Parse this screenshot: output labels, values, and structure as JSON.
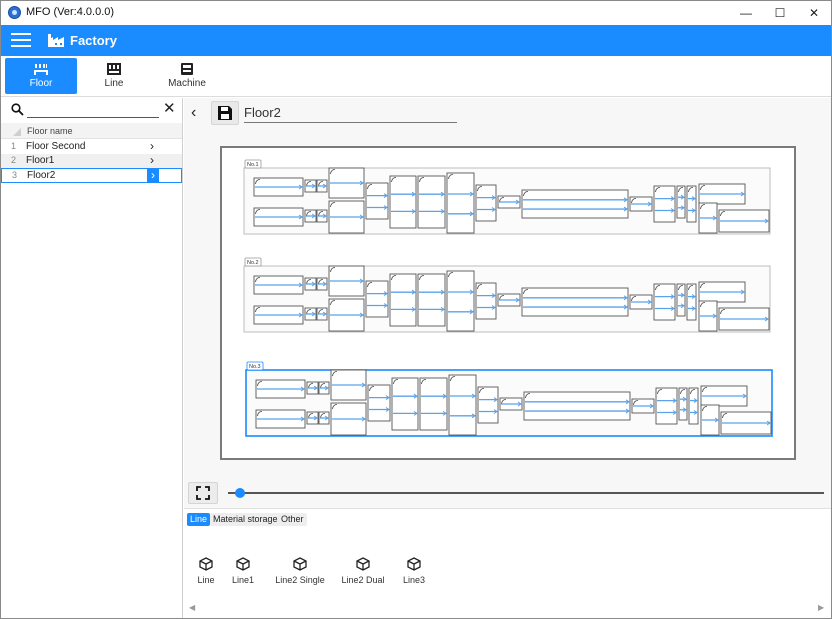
{
  "window": {
    "title": "MFO (Ver:4.0.0.0)",
    "minimize": "—",
    "maximize": "☐",
    "close": "✕"
  },
  "header": {
    "title": "Factory",
    "menu_icon": "hamburger-icon",
    "app_icon": "factory-icon"
  },
  "tabs": [
    {
      "label": "Floor",
      "icon": "floor-icon",
      "active": true
    },
    {
      "label": "Line",
      "icon": "line-icon",
      "active": false
    },
    {
      "label": "Machine",
      "icon": "machine-icon",
      "active": false
    }
  ],
  "search": {
    "value": "",
    "placeholder": ""
  },
  "floor_list": {
    "column_header": "Floor name",
    "rows": [
      {
        "num": "1",
        "name": "Floor Second"
      },
      {
        "num": "2",
        "name": "Floor1"
      },
      {
        "num": "3",
        "name": "Floor2",
        "selected": true
      }
    ]
  },
  "editor": {
    "floor_name": "Floor2",
    "lines": [
      {
        "label": "No.1",
        "selected": false
      },
      {
        "label": "No.2",
        "selected": false
      },
      {
        "label": "No.3",
        "selected": true
      }
    ],
    "zoom_level": 0.02
  },
  "palette": {
    "tabs": [
      {
        "label": "Line",
        "active": true
      },
      {
        "label": "Material storage",
        "active": false
      },
      {
        "label": "Other",
        "active": false
      }
    ],
    "items": [
      "Line",
      "Line1",
      "Line2 Single",
      "Line2 Dual",
      "Line3"
    ]
  },
  "colors": {
    "accent": "#1a8cff",
    "flow_arrow": "#5aa3ea",
    "selection": "#1a8cff"
  }
}
